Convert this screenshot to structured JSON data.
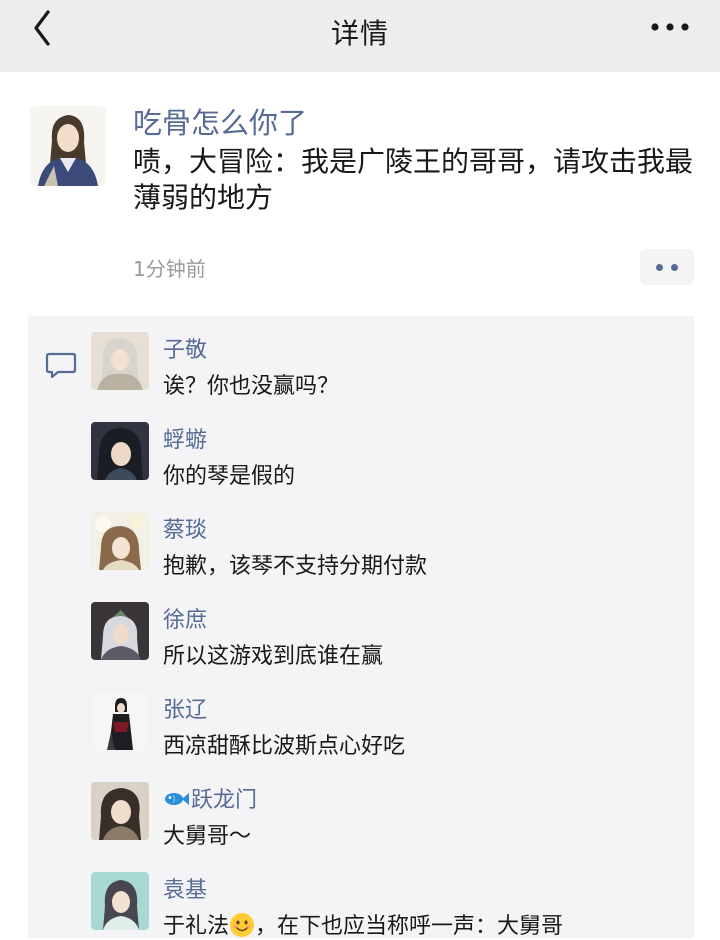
{
  "nav": {
    "title": "详情"
  },
  "post": {
    "author": "吃骨怎么你了",
    "text": "啧，大冒险：我是广陵王的哥哥，请攻击我最薄弱的地方",
    "time": "1分钟前"
  },
  "comments": [
    {
      "name": "子敬",
      "text": "诶？你也没赢吗？"
    },
    {
      "name": "蜉蝣",
      "text": "你的琴是假的"
    },
    {
      "name": "蔡琰",
      "text": "抱歉，该琴不支持分期付款"
    },
    {
      "name": "徐庶",
      "text": "所以这游戏到底谁在赢"
    },
    {
      "name": "张辽",
      "text": "西凉甜酥比波斯点心好吃"
    },
    {
      "name": "跃龙门",
      "text": "大舅哥～"
    },
    {
      "name": "袁基",
      "text_before": "于礼法",
      "text_after": "，在下也应当称呼一声：大舅哥"
    }
  ],
  "colors": {
    "name_link": "#576b95",
    "navbar_bg": "#ededed",
    "comment_bg": "#f4f4f6"
  }
}
